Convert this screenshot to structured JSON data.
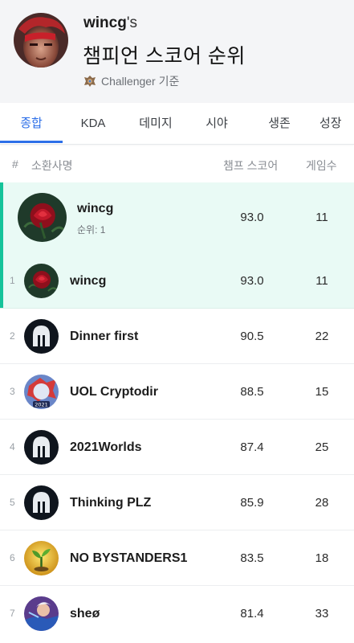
{
  "profile": {
    "username": "wincg",
    "possessive": "'s",
    "title": "챔피언 스코어 순위",
    "tier_icon": "challenger-emblem-icon",
    "tier_text": "Challenger 기준"
  },
  "tabs": [
    {
      "label": "종합",
      "active": true
    },
    {
      "label": "KDA",
      "active": false
    },
    {
      "label": "데미지",
      "active": false
    },
    {
      "label": "시야",
      "active": false
    },
    {
      "label": "생존",
      "active": false
    },
    {
      "label": "성장",
      "active": false
    }
  ],
  "columns": {
    "rank": "#",
    "summoner": "소환사명",
    "score": "챔프 스코어",
    "games": "게임수"
  },
  "my_rank": {
    "name": "wincg",
    "rank_label": "순위: 1",
    "score": "93.0",
    "games": "11",
    "avatar": "rose-icon"
  },
  "rows": [
    {
      "rank": "1",
      "name": "wincg",
      "score": "93.0",
      "games": "11",
      "avatar": "rose-icon",
      "highlight": true
    },
    {
      "rank": "2",
      "name": "Dinner first",
      "score": "90.5",
      "games": "22",
      "avatar": "spartan-helmet-icon",
      "highlight": false
    },
    {
      "rank": "3",
      "name": "UOL Cryptodir",
      "score": "88.5",
      "games": "15",
      "avatar": "worlds-2021-icon",
      "highlight": false,
      "avatar_text": "2021"
    },
    {
      "rank": "4",
      "name": "2021Worlds",
      "score": "87.4",
      "games": "25",
      "avatar": "spartan-helmet-icon",
      "highlight": false
    },
    {
      "rank": "5",
      "name": "Thinking PLZ",
      "score": "85.9",
      "games": "28",
      "avatar": "spartan-helmet-icon",
      "highlight": false
    },
    {
      "rank": "6",
      "name": "NO BYSTANDERS1",
      "score": "83.5",
      "games": "18",
      "avatar": "sprout-icon",
      "highlight": false
    },
    {
      "rank": "7",
      "name": "sheø",
      "score": "81.4",
      "games": "33",
      "avatar": "champion-portrait-icon",
      "highlight": false
    }
  ],
  "colors": {
    "accent": "#2d6fe8",
    "highlight_bg": "#e9faf5",
    "highlight_bar": "#15c39a",
    "header_bg": "#f4f5f7"
  }
}
